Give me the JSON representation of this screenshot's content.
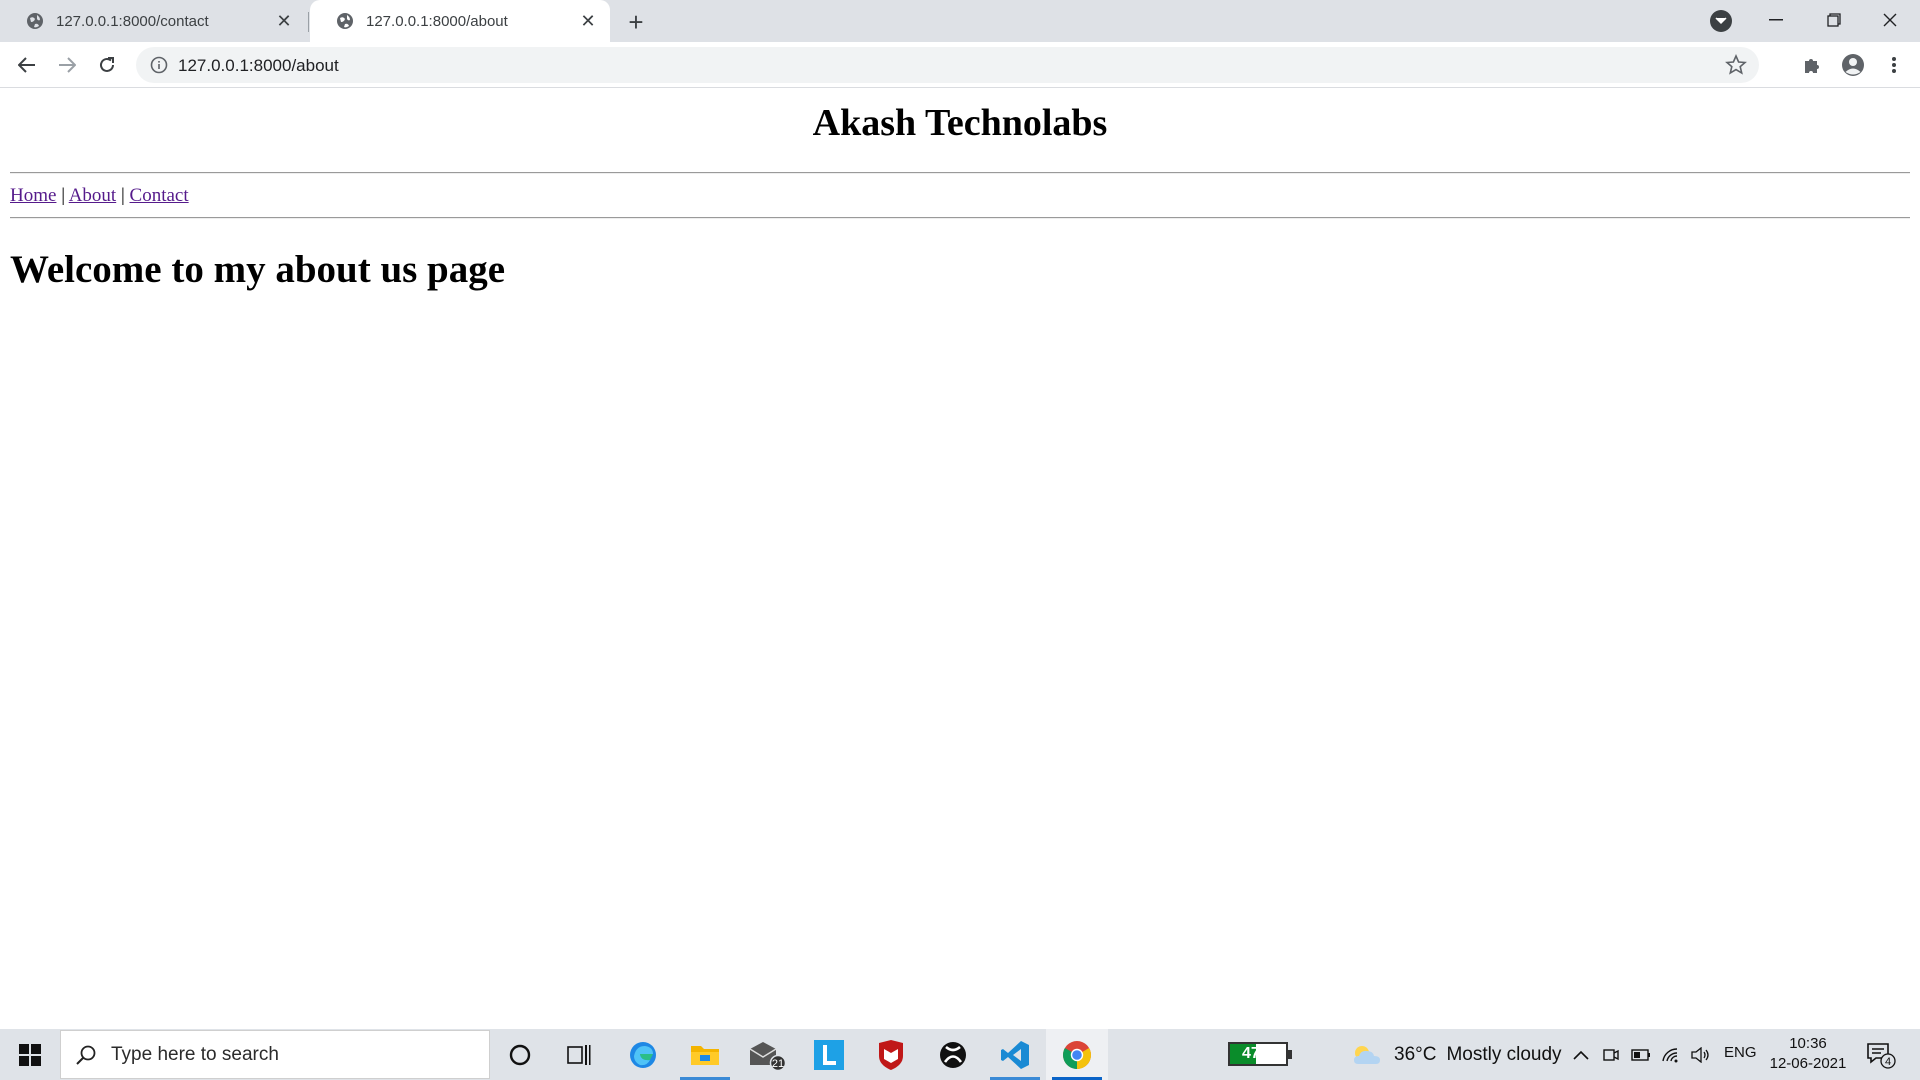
{
  "browser": {
    "tabs": [
      {
        "title": "127.0.0.1:8000/contact",
        "active": false
      },
      {
        "title": "127.0.0.1:8000/about",
        "active": true
      }
    ],
    "url": "127.0.0.1:8000/about",
    "new_tab_label": "+"
  },
  "page": {
    "site_title": "Akash Technolabs",
    "nav": {
      "home": "Home",
      "about": "About",
      "contact": "Contact",
      "separator": "|"
    },
    "heading": "Welcome to my about us page"
  },
  "taskbar": {
    "search_placeholder": "Type here to search",
    "mail_badge": "21",
    "battery_percent": "47%",
    "battery_level": 0.47,
    "weather_temp": "36°C",
    "weather_desc": "Mostly cloudy",
    "language": "ENG",
    "time": "10:36",
    "date": "12-06-2021",
    "notification_count": "4"
  },
  "colors": {
    "tabstrip": "#dee1e6",
    "visited_link": "#551a8b",
    "taskbar": "#dfe3e8",
    "battery_fill": "#0a8c2a"
  }
}
